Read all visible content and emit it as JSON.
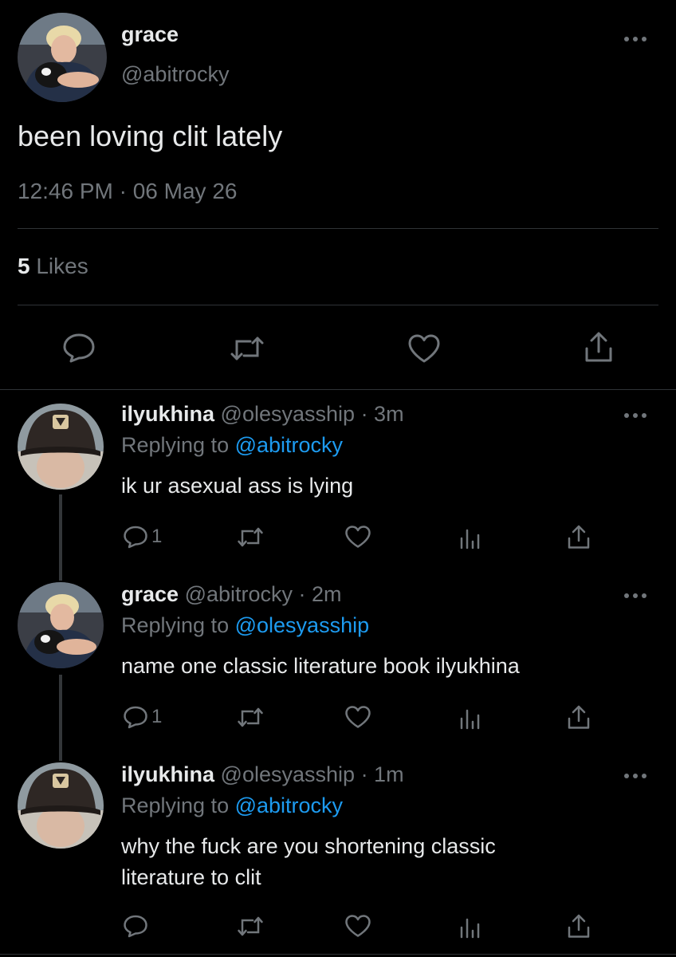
{
  "main_tweet": {
    "name": "grace",
    "handle": "@abitrocky",
    "text": "been loving clit lately",
    "timestamp": "12:46 PM · 06 May 26",
    "likes_count": "5",
    "likes_label": "Likes"
  },
  "replies": [
    {
      "name": "ilyukhina",
      "handle": "@olesyasship",
      "time": "· 3m",
      "replying_prefix": "Replying to",
      "replying_to": "@abitrocky",
      "text": "ik ur asexual ass is lying",
      "reply_count": "1"
    },
    {
      "name": "grace",
      "handle": "@abitrocky",
      "time": "· 2m",
      "replying_prefix": "Replying to",
      "replying_to": "@olesyasship",
      "text": "name one classic literature book ilyukhina",
      "reply_count": "1"
    },
    {
      "name": "ilyukhina",
      "handle": "@olesyasship",
      "time": "· 1m",
      "replying_prefix": "Replying to",
      "replying_to": "@abitrocky",
      "text_line1": "why the fuck are you shortening classic",
      "text_line2": "literature to clit"
    }
  ],
  "colors": {
    "background": "#000000",
    "text": "#e7e9ea",
    "secondary": "#71767b",
    "accent": "#1d9bf0",
    "divider": "#2f3336"
  },
  "icons": {
    "reply": "speech-bubble-icon",
    "retweet": "retweet-icon",
    "like": "heart-icon",
    "share": "share-icon",
    "views": "bar-chart-icon",
    "more": "more-dots-icon"
  }
}
